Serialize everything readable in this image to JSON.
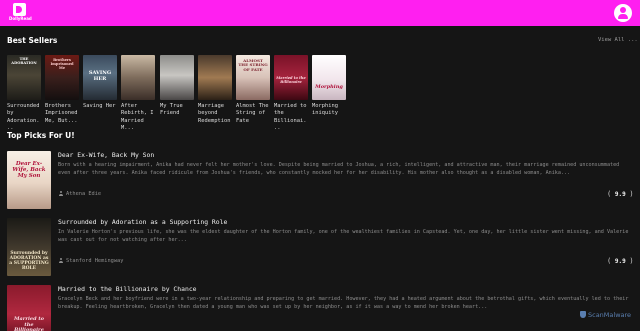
{
  "header": {
    "logo_text": "DollyRead",
    "accent": "#ff1ff0"
  },
  "best_sellers": {
    "title": "Best Sellers",
    "view_all": "View All ...",
    "items": [
      {
        "title": "Surrounded by Adoration...",
        "cover_text": "THE ADORATION"
      },
      {
        "title": "Brothers Imprisoned Me, But...",
        "cover_text": "Brothers Imprisoned Me"
      },
      {
        "title": "Saving Her",
        "cover_text": "SAVING HER"
      },
      {
        "title": "After Rebirth, I Married M...",
        "cover_text": ""
      },
      {
        "title": "My True Friend",
        "cover_text": ""
      },
      {
        "title": "Marriage beyond Redemption",
        "cover_text": ""
      },
      {
        "title": "Almost The String of Fate",
        "cover_text": "ALMOST THE STRING OF FATE"
      },
      {
        "title": "Married to the Billionai...",
        "cover_text": "Married to the Billionaire"
      },
      {
        "title": "Morphing iniquity",
        "cover_text": "Morphing"
      }
    ]
  },
  "top_picks": {
    "title": "Top Picks For U!",
    "items": [
      {
        "title": "Dear Ex-Wife, Back My Son",
        "description": "Born with a hearing impairment, Anika had never felt her mother's love. Despite being married to Joshua, a rich, intelligent, and attractive man, their marriage remained unconsummated even after three years. Anika faced ridicule from Joshua's friends, who constantly mocked her for her disability. His mother also thought as a disabled woman, Anika...",
        "author": "Athena Edie",
        "rating": "9.9",
        "cover_text": "Dear Ex-Wife, Back My Son"
      },
      {
        "title": "Surrounded by Adoration as a Supporting Role",
        "description": "In Valerie Horton's previous life, she was the eldest daughter of the Horton family, one of the wealthiest families in Capstead. Yet, one day, her little sister went missing, and Valerie was cast out for not watching after her...",
        "author": "Stanford Hemingway",
        "rating": "9.9",
        "cover_text": "Surrounded by ADORATION as a SUPPORTING ROLE"
      },
      {
        "title": "Married to the Billionaire by Chance",
        "description": "Gracelyn Beck and her boyfriend were in a two-year relationship and preparing to get married. However, they had a heated argument about the betrothal gifts, which eventually led to their breakup. Feeling heartbroken, Gracelyn then dated a young man who was set up by her neighbor, as if it was a way to mend her broken heart...",
        "author": "",
        "rating": "",
        "cover_text": "Married to the Billionaire"
      }
    ]
  },
  "watermark": {
    "text": "ScanMalware"
  }
}
